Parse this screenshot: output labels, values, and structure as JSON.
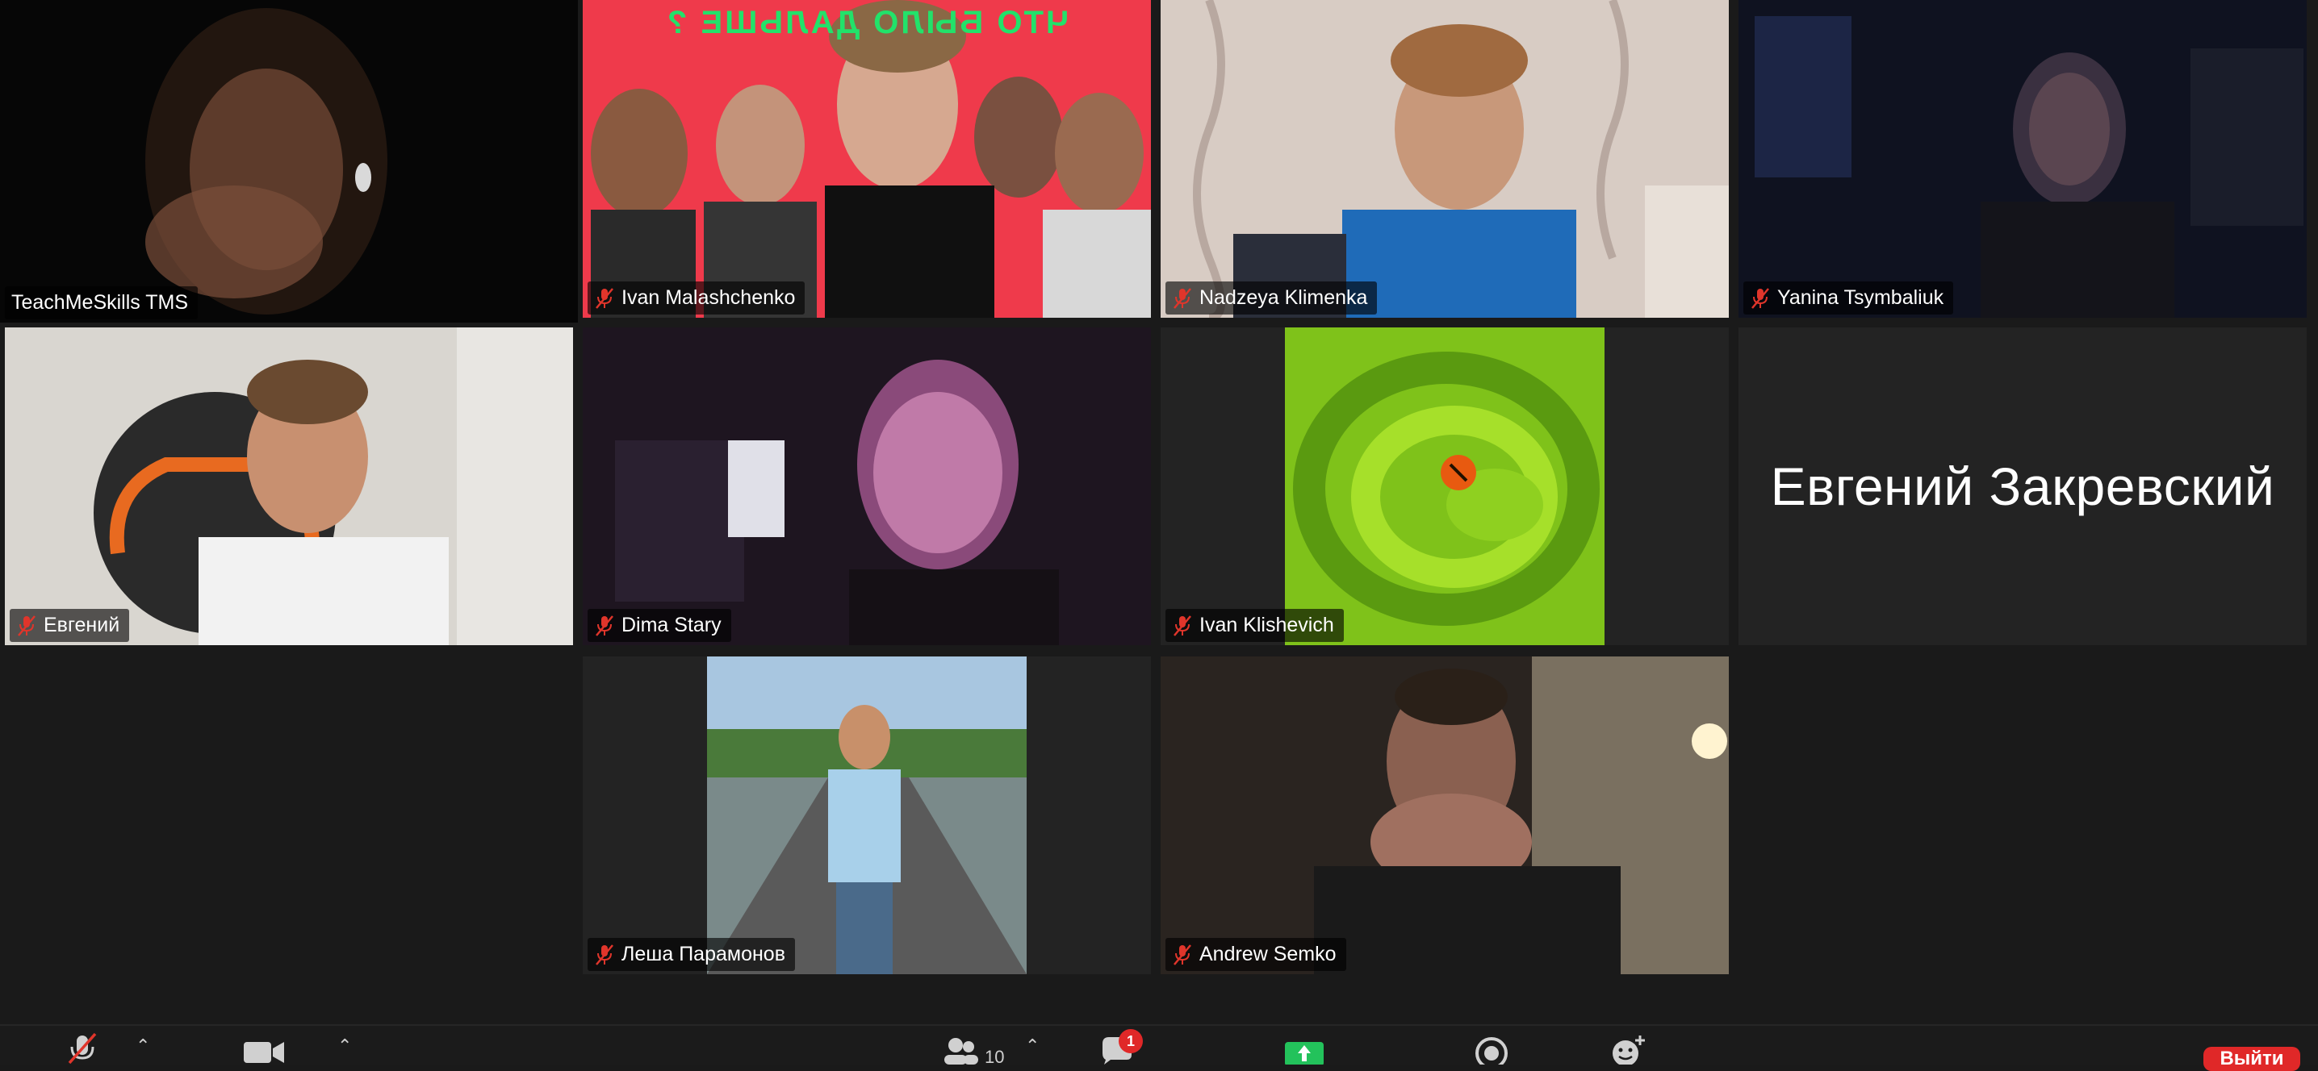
{
  "participants": [
    {
      "name": "TeachMeSkills TMS",
      "muted": false
    },
    {
      "name": "Ivan Malashchenko",
      "muted": true
    },
    {
      "name": "Nadzeya Klimenka",
      "muted": true
    },
    {
      "name": "Yanina Tsymbaliuk",
      "muted": true
    },
    {
      "name": "Евгений",
      "muted": true
    },
    {
      "name": "Dima Stary",
      "muted": true
    },
    {
      "name": "Ivan Klishevich",
      "muted": true
    },
    {
      "name": "Евгений Закревский",
      "muted": true
    },
    {
      "name": "Леша Парамонов",
      "muted": true
    },
    {
      "name": "Andrew Semko",
      "muted": true
    }
  ],
  "banner_text": "ЧТО БЫЛО ДАЛЬШЕ ?",
  "toolbar": {
    "participant_count": "10",
    "chat_badge": "1",
    "leave_label": "Выйти"
  },
  "colors": {
    "active_speaker": "#c5e08a",
    "muted_red": "#e0352b",
    "share_green": "#23c25b",
    "leave_red": "#e02828"
  }
}
